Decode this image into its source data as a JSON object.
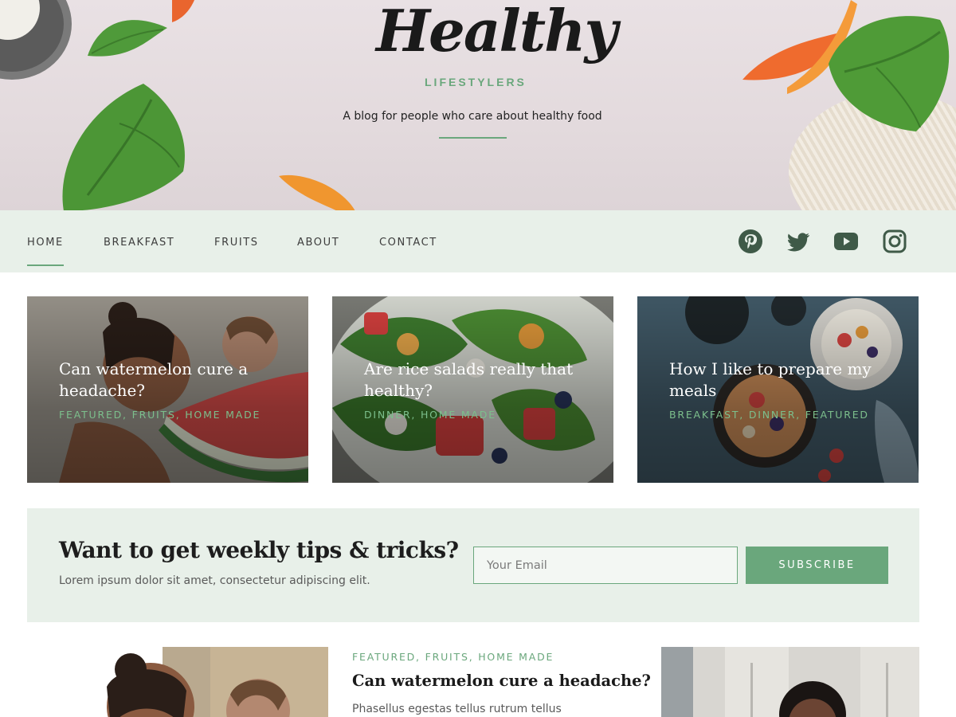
{
  "header": {
    "logo_script": "Healthy",
    "logo_sub": "LIFESTYLERS",
    "tagline": "A blog for people who care about healthy food"
  },
  "nav": {
    "items": [
      {
        "label": "HOME",
        "active": true
      },
      {
        "label": "BREAKFAST",
        "active": false
      },
      {
        "label": "FRUITS",
        "active": false
      },
      {
        "label": "ABOUT",
        "active": false
      },
      {
        "label": "CONTACT",
        "active": false
      }
    ],
    "social": [
      "pinterest-icon",
      "twitter-icon",
      "youtube-icon",
      "instagram-icon"
    ]
  },
  "featured": [
    {
      "title": "Can watermelon cure a headache?",
      "categories": "FEATURED, FRUITS, HOME MADE"
    },
    {
      "title": "Are rice salads really that healthy?",
      "categories": "DINNER, HOME MADE"
    },
    {
      "title": "How I like to prepare my meals",
      "categories": "BREAKFAST, DINNER, FEATURED"
    }
  ],
  "newsletter": {
    "title": "Want to get weekly tips & tricks?",
    "subtitle": "Lorem ipsum dolor sit amet, consectetur adipiscing elit.",
    "email_placeholder": "Your Email",
    "button_label": "SUBSCRIBE"
  },
  "post": {
    "categories": "FEATURED, FRUITS, HOME MADE",
    "title": "Can watermelon cure a headache?",
    "excerpt": "Phasellus egestas tellus rutrum tellus"
  },
  "colors": {
    "accent": "#6aa77c",
    "nav_bg": "#e8f0e9",
    "social_icon": "#3f5a48"
  }
}
